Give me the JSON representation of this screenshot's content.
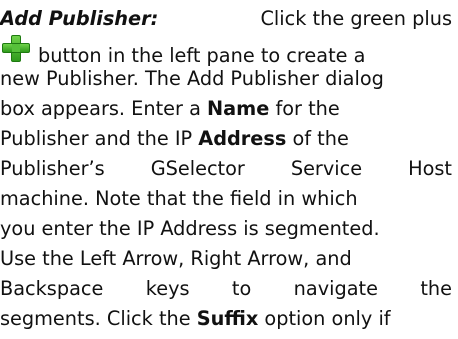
{
  "heading": "Add Publisher:",
  "lines": {
    "l1": [
      "Click the green plus"
    ],
    "l2": "button in the left pane to create a",
    "l3": "new Publisher. The Add Publisher dialog",
    "l4a": "box appears. Enter a ",
    "l4b": "Name",
    "l4c": " for the",
    "l5a": "Publisher and the IP ",
    "l5b": "Address",
    "l5c": " of the",
    "l6": [
      "Publisher’s",
      "GSelector",
      "Service",
      "Host"
    ],
    "l7": "machine. Note that the field in which",
    "l8": "you enter the IP Address is segmented.",
    "l9": "Use the Left Arrow, Right Arrow, and",
    "l10": [
      "Backspace",
      "keys",
      "to",
      "navigate",
      "the"
    ],
    "l11a": "segments. Click the ",
    "l11b": "Suffix",
    "l11c": " option only if"
  },
  "icon": "green-plus-icon"
}
